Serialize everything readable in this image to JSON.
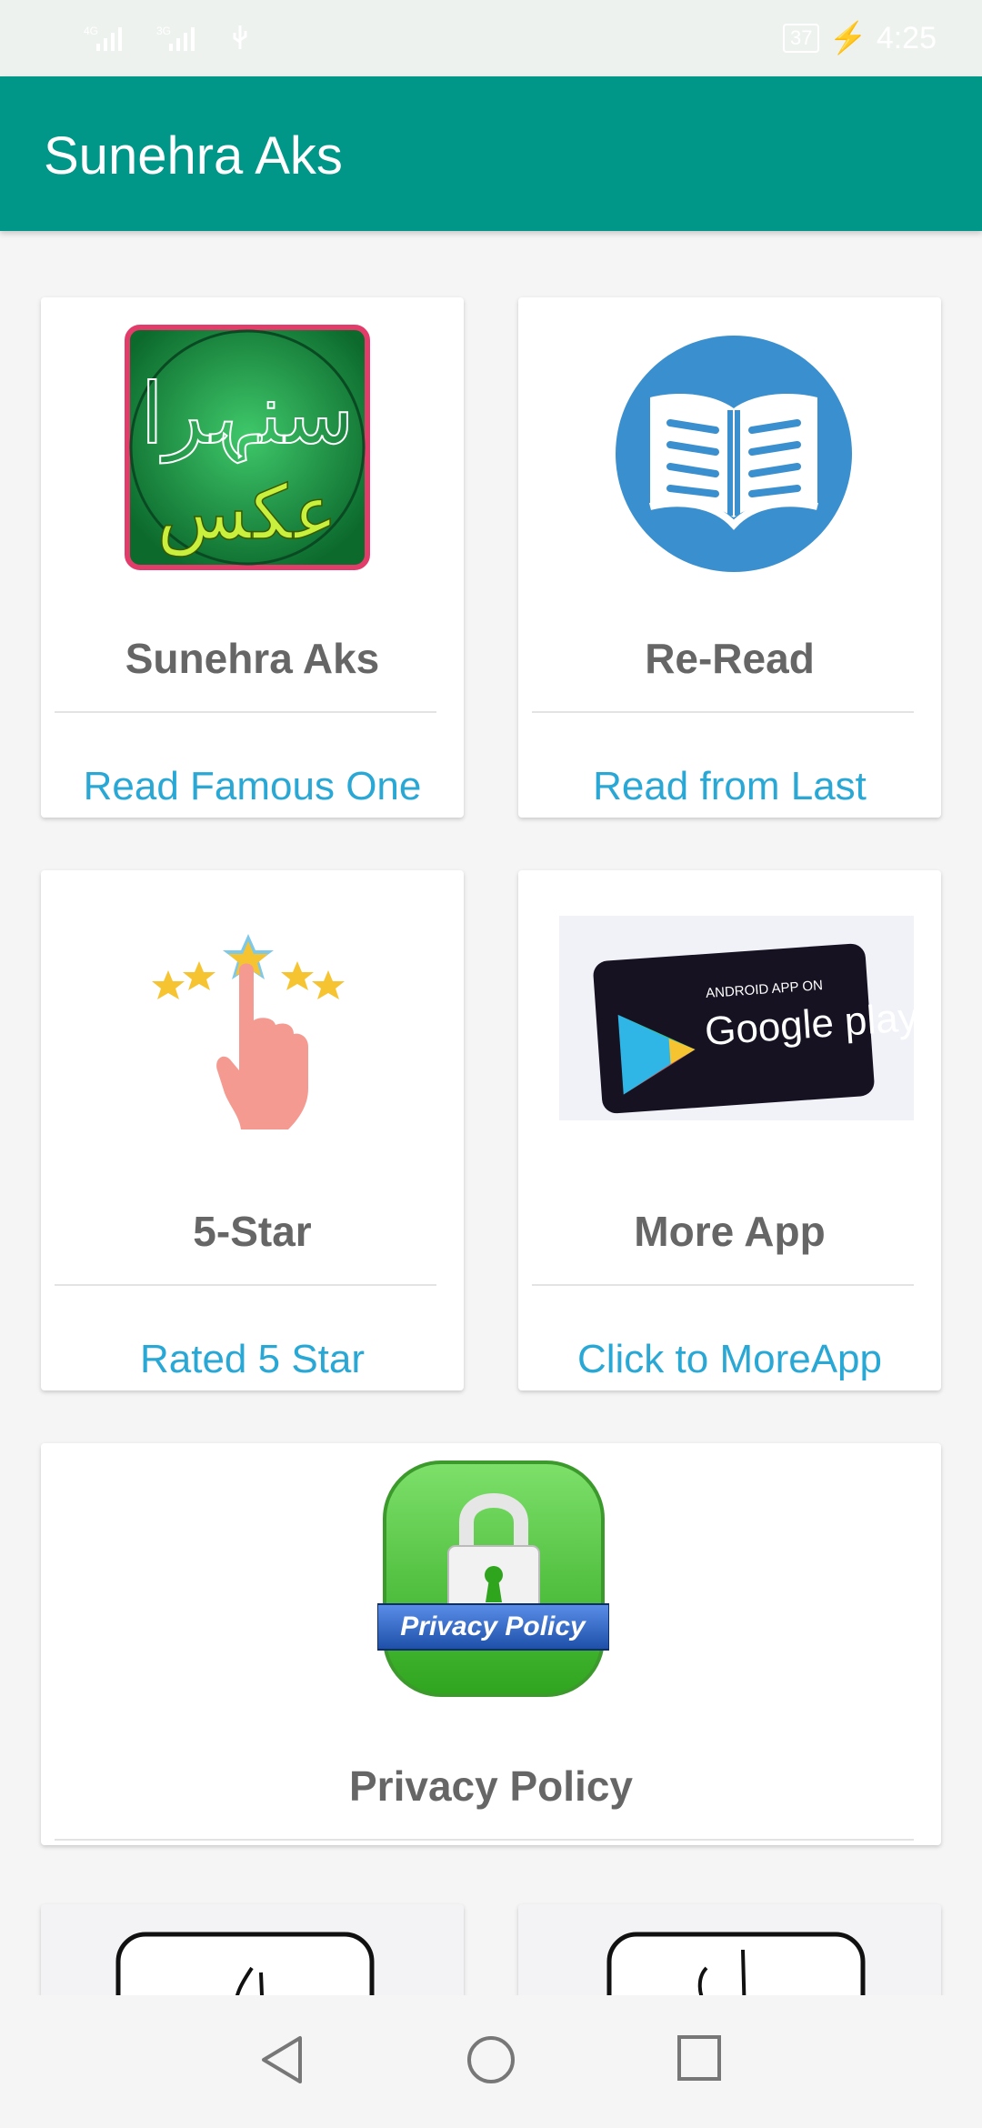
{
  "status_bar": {
    "network_1": "4G",
    "network_2": "3G",
    "battery": "37",
    "time": "4:25"
  },
  "app_bar": {
    "title": "Sunehra Aks"
  },
  "cards": [
    {
      "title": "Sunehra Aks",
      "link": "Read Famous One",
      "icon": "sunehra-aks-logo-icon"
    },
    {
      "title": "Re-Read",
      "link": "Read from Last",
      "icon": "open-book-icon"
    },
    {
      "title": "5-Star",
      "link": "Rated 5 Star",
      "icon": "five-star-rating-icon"
    },
    {
      "title": "More App",
      "link": "Click to MoreApp",
      "icon": "google-play-badge-icon"
    },
    {
      "title": "Privacy Policy",
      "icon": "privacy-policy-lock-icon",
      "badge_text": "Privacy Policy"
    }
  ],
  "play_badge": {
    "line1": "ANDROID APP ON",
    "line2": "Google play"
  },
  "logo_text": {
    "top": "سنہرا",
    "bottom": "عکس"
  },
  "colors": {
    "primary": "#009688",
    "link": "#29a8d6",
    "title": "#666666"
  },
  "nav": {
    "back": "back-icon",
    "home": "home-icon",
    "recents": "recents-icon"
  }
}
